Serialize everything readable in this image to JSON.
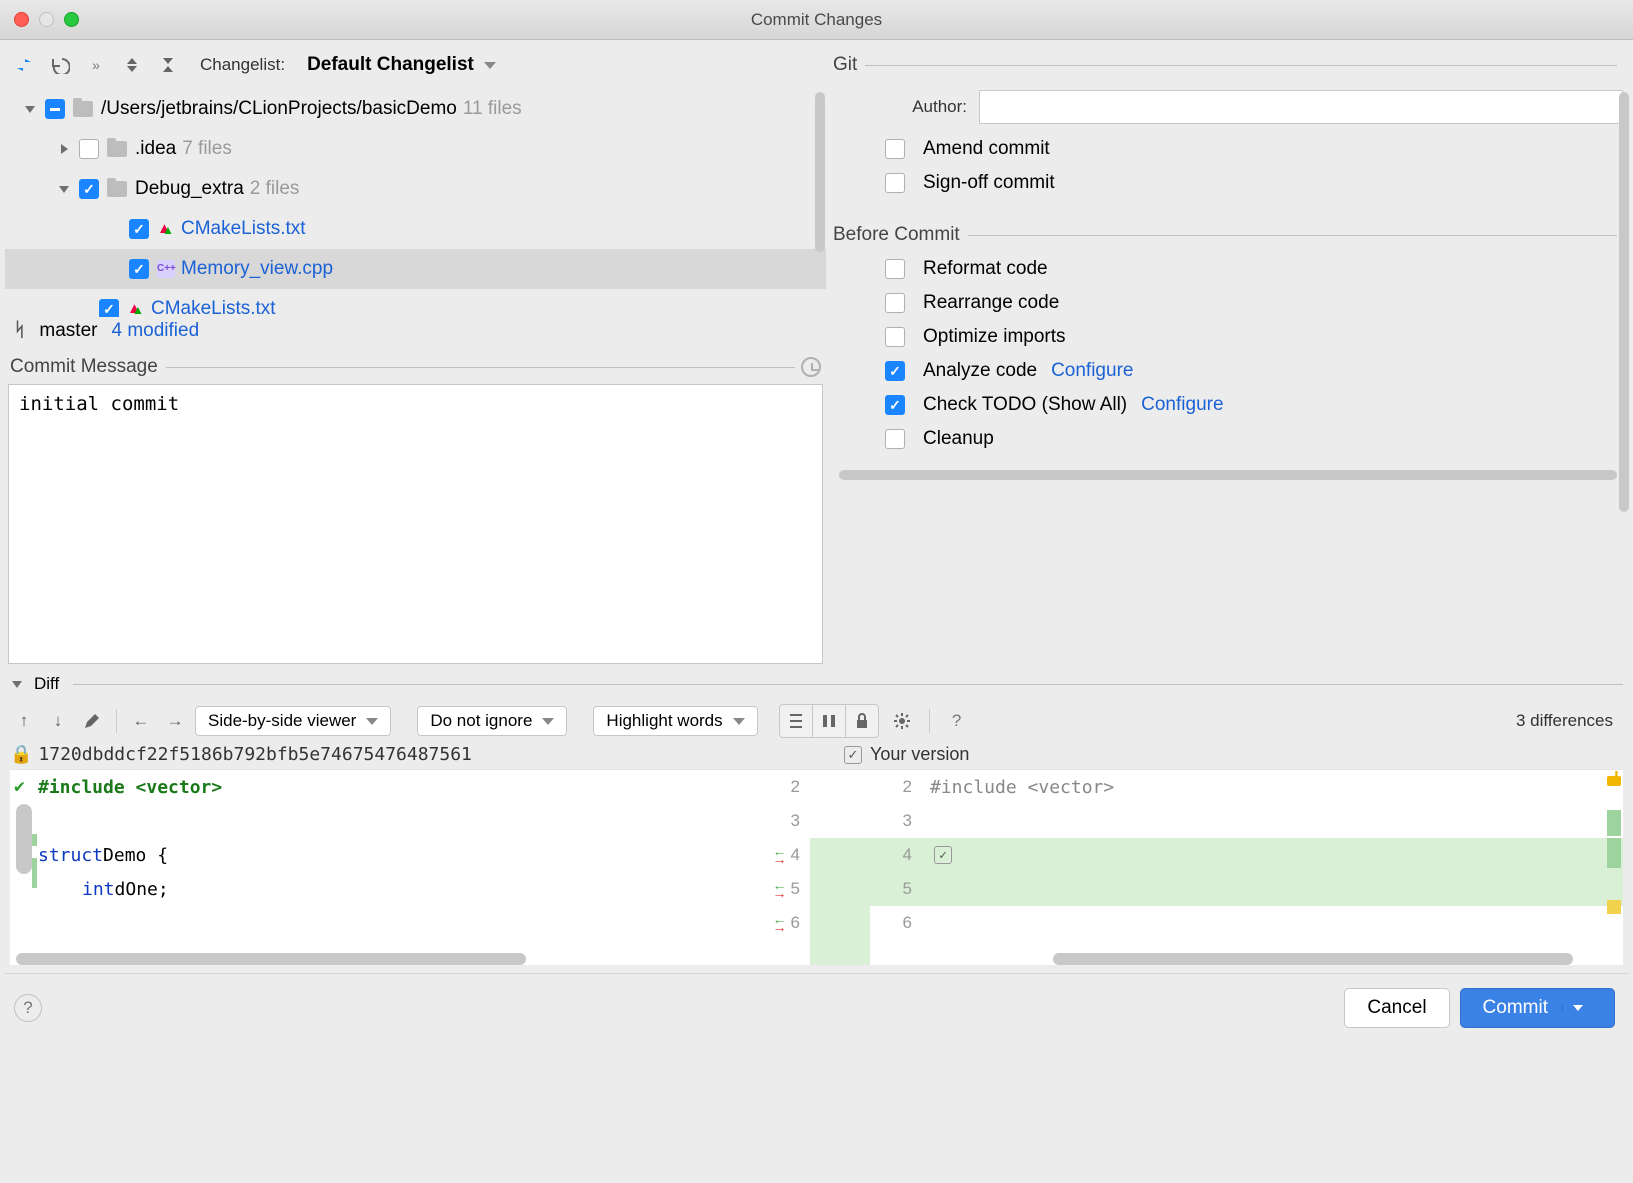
{
  "window": {
    "title": "Commit Changes"
  },
  "toolbar": {
    "changelist_label": "Changelist:",
    "changelist_name": "Default Changelist"
  },
  "tree": {
    "root_path": "/Users/jetbrains/CLionProjects/basicDemo",
    "root_count": "11 files",
    "items": [
      {
        "name": ".idea",
        "count": "7 files"
      },
      {
        "name": "Debug_extra",
        "count": "2 files"
      },
      {
        "name": "CMakeLists.txt"
      },
      {
        "name": "Memory_view.cpp"
      },
      {
        "name": "CMakeLists.txt"
      }
    ]
  },
  "branch": {
    "name": "master",
    "modified": "4 modified"
  },
  "commit_message": {
    "label": "Commit Message",
    "value": "initial commit"
  },
  "git": {
    "section": "Git",
    "author_label": "Author:",
    "author_value": "",
    "amend": "Amend commit",
    "signoff": "Sign-off commit"
  },
  "before": {
    "section": "Before Commit",
    "reformat": "Reformat code",
    "rearrange": "Rearrange code",
    "optimize": "Optimize imports",
    "analyze": "Analyze code",
    "todo": "Check TODO (Show All)",
    "cleanup": "Cleanup",
    "configure": "Configure"
  },
  "diff": {
    "label": "Diff",
    "viewer": "Side-by-side viewer",
    "ignore": "Do not ignore",
    "highlight": "Highlight words",
    "count": "3 differences",
    "left_hash": "1720dbddcf22f5186b792bfb5e74675476487561",
    "right_label": "Your version",
    "left_lines": {
      "l1": "#include <vector>",
      "l2": "struct",
      "l2b": " Demo {",
      "l3": "int",
      "l3b": " dOne;"
    },
    "right_lines": {
      "l1": "#include <vector>"
    },
    "gut_l": {
      "n2": "2",
      "n3": "3",
      "n4": "4",
      "n5": "5",
      "n6": "6"
    },
    "gut_r": {
      "n2": "2",
      "n3": "3",
      "n4": "4",
      "n5": "5",
      "n6": "6"
    }
  },
  "footer": {
    "cancel": "Cancel",
    "commit": "Commit"
  }
}
